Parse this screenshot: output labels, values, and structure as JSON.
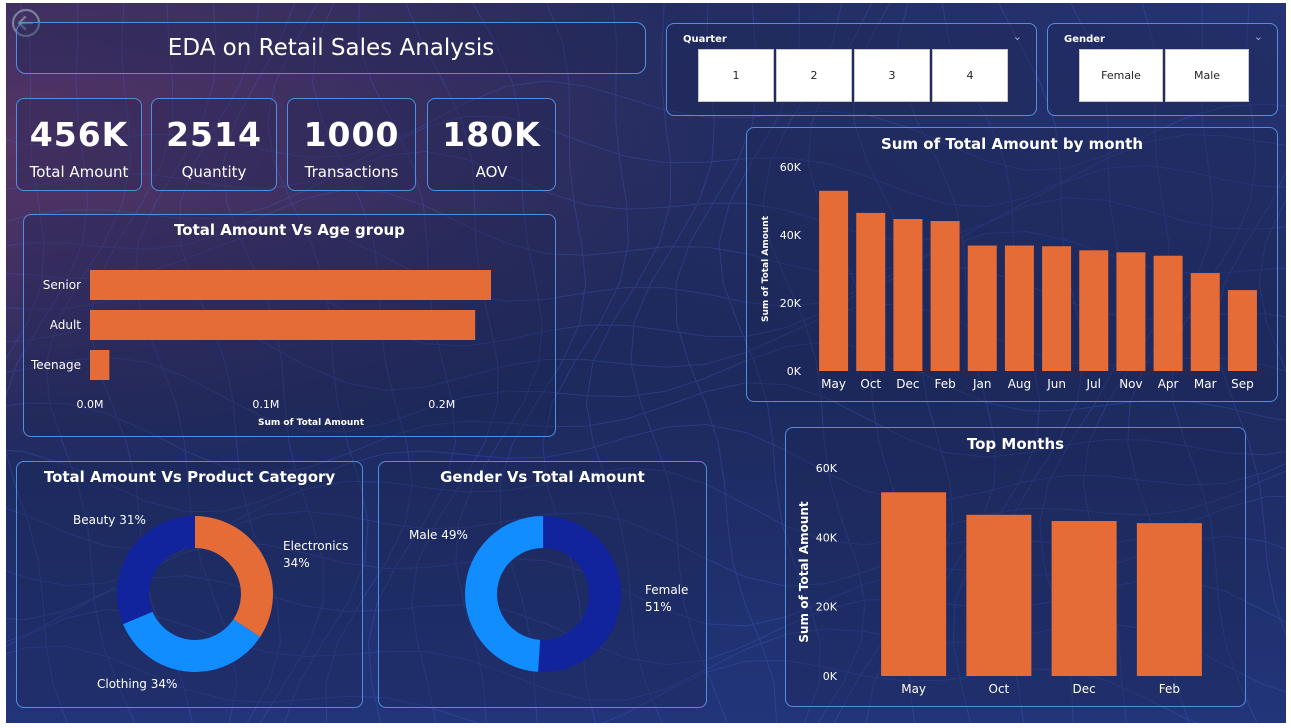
{
  "title": "EDA on Retail Sales Analysis",
  "kpis": [
    {
      "value": "456K",
      "label": "Total Amount"
    },
    {
      "value": "2514",
      "label": "Quantity"
    },
    {
      "value": "1000",
      "label": "Transactions"
    },
    {
      "value": "180K",
      "label": "AOV"
    }
  ],
  "slicers": {
    "quarter": {
      "title": "Quarter",
      "options": [
        "1",
        "2",
        "3",
        "4"
      ]
    },
    "gender": {
      "title": "Gender",
      "options": [
        "Female",
        "Male"
      ]
    }
  },
  "colors": {
    "bar": "#e66c37",
    "donut_dark": "#12239e",
    "donut_light": "#118dff",
    "border": "#4f8fe0"
  },
  "chart_data": [
    {
      "id": "age",
      "type": "bar",
      "orientation": "horizontal",
      "title": "Total Amount Vs Age group",
      "categories": [
        "Senior",
        "Adult",
        "Teenage"
      ],
      "values": [
        228000,
        219000,
        11000
      ],
      "xlabel": "Sum of Total Amount",
      "ticks": [
        0,
        100000,
        200000
      ],
      "tick_labels": [
        "0.0M",
        "0.1M",
        "0.2M"
      ],
      "xlim": [
        0,
        228000
      ],
      "grid": false
    },
    {
      "id": "month",
      "type": "bar",
      "title": "Sum of Total Amount by month",
      "categories": [
        "May",
        "Oct",
        "Dec",
        "Feb",
        "Jan",
        "Aug",
        "Jun",
        "Jul",
        "Nov",
        "Apr",
        "Mar",
        "Sep"
      ],
      "values": [
        53000,
        46500,
        44700,
        44100,
        36900,
        36900,
        36700,
        35500,
        34900,
        33900,
        28800,
        23800
      ],
      "ylabel": "Sum of Total Amount",
      "ticks": [
        0,
        20000,
        40000,
        60000
      ],
      "tick_labels": [
        "0K",
        "20K",
        "40K",
        "60K"
      ],
      "ylim": [
        0,
        60000
      ],
      "grid": false
    },
    {
      "id": "top",
      "type": "bar",
      "title": "Top Months",
      "categories": [
        "May",
        "Oct",
        "Dec",
        "Feb"
      ],
      "values": [
        53000,
        46500,
        44700,
        44100
      ],
      "ylabel": "Sum of Total Amount",
      "ticks": [
        0,
        20000,
        40000,
        60000
      ],
      "tick_labels": [
        "0K",
        "20K",
        "40K",
        "60K"
      ],
      "ylim": [
        0,
        60000
      ],
      "grid": false
    },
    {
      "id": "category",
      "type": "pie",
      "donut": true,
      "title": "Total Amount Vs Product Category",
      "slices": [
        {
          "label": "Electronics",
          "pct_label": "34%",
          "value": 34.3,
          "color": "#e66c37"
        },
        {
          "label": "Clothing",
          "pct_label": "34%",
          "value": 34.4,
          "color": "#118dff"
        },
        {
          "label": "Beauty",
          "pct_label": "31%",
          "value": 31.3,
          "color": "#12239e"
        }
      ]
    },
    {
      "id": "gender",
      "type": "pie",
      "donut": true,
      "title": "Gender Vs Total Amount",
      "slices": [
        {
          "label": "Female",
          "pct_label": "51%",
          "value": 51,
          "color": "#12239e"
        },
        {
          "label": "Male",
          "pct_label": "49%",
          "value": 49,
          "color": "#118dff"
        }
      ]
    }
  ]
}
